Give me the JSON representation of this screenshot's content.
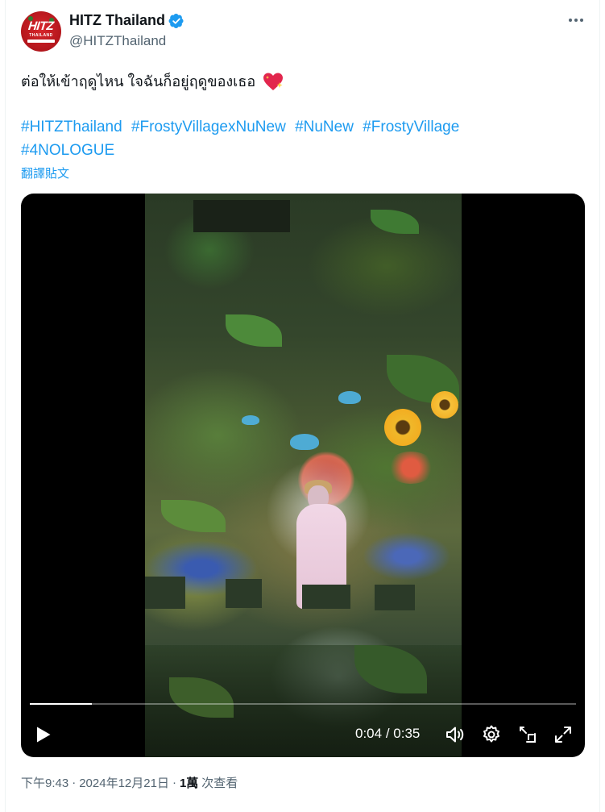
{
  "author": {
    "display_name": "HITZ Thailand",
    "handle": "@HITZThailand",
    "avatar_text": "HITZ",
    "avatar_subtext": "THAILAND",
    "verified": true
  },
  "tweet": {
    "text": "ต่อให้เข้าฤดูไหน ใจฉันก็อยู่ฤดูของเธอ",
    "emoji_icon": "sparkling-heart",
    "hashtags": [
      "#HITZThailand",
      "#FrostyVillagexNuNew",
      "#NuNew",
      "#FrostyVillage",
      "#4NOLOGUE"
    ],
    "translate_label": "翻譯貼文"
  },
  "video": {
    "current_time": "0:04",
    "separator": " / ",
    "duration": "0:35",
    "progress_fraction": 0.1143,
    "controls": [
      "play-icon",
      "volume-icon",
      "settings-icon",
      "picture-in-picture-icon",
      "fullscreen-icon"
    ]
  },
  "meta": {
    "time": "下午9:43",
    "date": "2024年12月21日",
    "views_count": "1萬",
    "views_label": "次查看"
  },
  "colors": {
    "link": "#1d9bf0",
    "secondary_text": "#536471",
    "verified_badge": "#1d9bf0",
    "avatar_red": "#c8161d"
  }
}
